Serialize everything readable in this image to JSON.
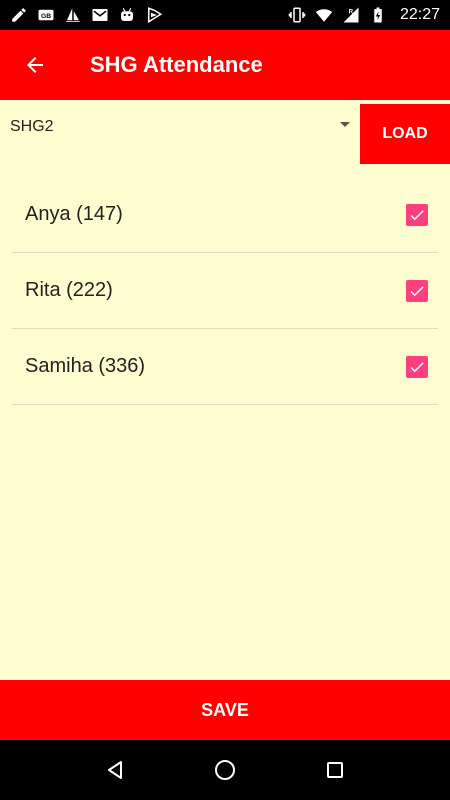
{
  "status_bar": {
    "time": "22:27",
    "left_icons": [
      "edit-icon",
      "gb-badge-icon",
      "sailing-icon",
      "mail-icon",
      "android-icon",
      "play-protect-icon"
    ],
    "right_icons": [
      "vibrate-icon",
      "wifi-icon",
      "signal-roaming-icon",
      "battery-charging-icon"
    ]
  },
  "app_bar": {
    "title": "SHG Attendance"
  },
  "selector": {
    "selected_value": "SHG2",
    "load_label": "LOAD"
  },
  "members": [
    {
      "label": "Anya (147)",
      "checked": true
    },
    {
      "label": "Rita (222)",
      "checked": true
    },
    {
      "label": "Samiha (336)",
      "checked": true
    }
  ],
  "footer": {
    "save_label": "SAVE"
  },
  "colors": {
    "accent": "#ff0000",
    "checkbox": "#ff3f80",
    "background": "#fdfdd0"
  }
}
